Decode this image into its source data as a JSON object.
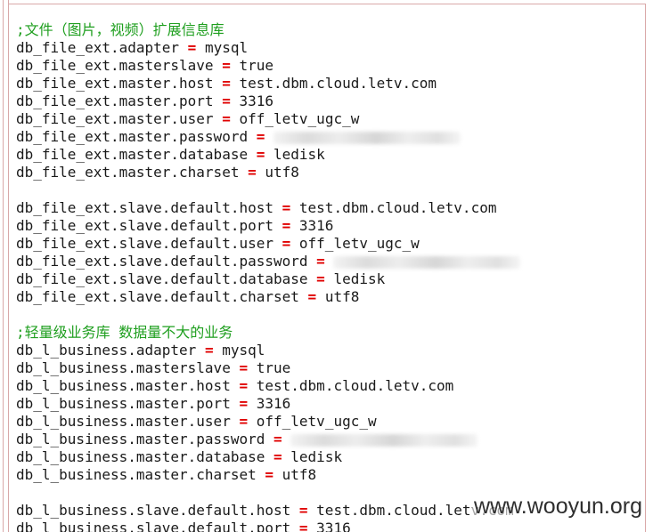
{
  "comments": {
    "file_ext": ";文件（图片，视频）扩展信息库",
    "light": ";轻量级业务库 数据量不大的业务"
  },
  "lines": {
    "l01": {
      "key": "db_file_ext.adapter",
      "value": "mysql"
    },
    "l02": {
      "key": "db_file_ext.masterslave",
      "value": "true"
    },
    "l03": {
      "key": "db_file_ext.master.host",
      "value": "test.dbm.cloud.letv.com"
    },
    "l04": {
      "key": "db_file_ext.master.port",
      "value": "3316"
    },
    "l05": {
      "key": "db_file_ext.master.user",
      "value": "off_letv_ugc_w"
    },
    "l06": {
      "key": "db_file_ext.master.password",
      "value": ""
    },
    "l07": {
      "key": "db_file_ext.master.database",
      "value": "ledisk"
    },
    "l08": {
      "key": "db_file_ext.master.charset",
      "value": "utf8"
    },
    "l09": {
      "key": "db_file_ext.slave.default.host",
      "value": "test.dbm.cloud.letv.com"
    },
    "l10": {
      "key": "db_file_ext.slave.default.port",
      "value": "3316"
    },
    "l11": {
      "key": "db_file_ext.slave.default.user",
      "value": "off_letv_ugc_w"
    },
    "l12": {
      "key": "db_file_ext.slave.default.password",
      "value": ""
    },
    "l13": {
      "key": "db_file_ext.slave.default.database",
      "value": "ledisk"
    },
    "l14": {
      "key": "db_file_ext.slave.default.charset",
      "value": "utf8"
    },
    "l15": {
      "key": "db_l_business.adapter",
      "value": "mysql"
    },
    "l16": {
      "key": "db_l_business.masterslave",
      "value": "true"
    },
    "l17": {
      "key": "db_l_business.master.host",
      "value": "test.dbm.cloud.letv.com"
    },
    "l18": {
      "key": "db_l_business.master.port",
      "value": "3316"
    },
    "l19": {
      "key": "db_l_business.master.user",
      "value": "off_letv_ugc_w"
    },
    "l20": {
      "key": "db_l_business.master.password",
      "value": ""
    },
    "l21": {
      "key": "db_l_business.master.database",
      "value": "ledisk"
    },
    "l22": {
      "key": "db_l_business.master.charset",
      "value": "utf8"
    },
    "l23": {
      "key": "db_l_business.slave.default.host",
      "value": "test.dbm.cloud.letv.com"
    },
    "l24": {
      "key": "db_l_business.slave.default.port",
      "value": "3316"
    }
  },
  "equals": "=",
  "watermark": "www.wooyun.org",
  "colors": {
    "comment": "#1f9f1f",
    "operator": "#e00000",
    "text": "#1a1a1a",
    "margin": "#d9a9a9"
  }
}
